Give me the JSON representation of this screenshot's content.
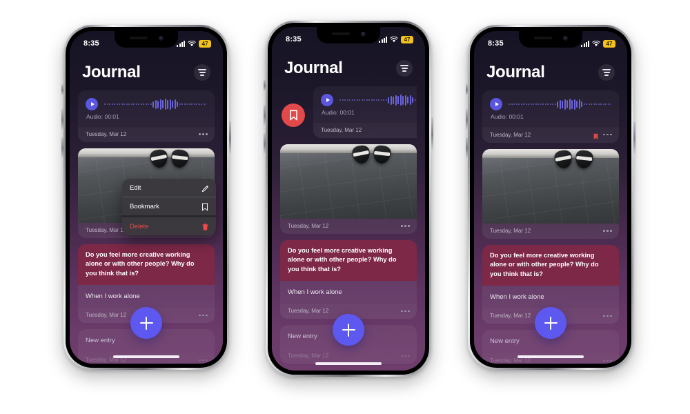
{
  "scene": {
    "background_color": "#ffffff",
    "device_count": 3,
    "app_name": "Journal"
  },
  "status_bar": {
    "time": "8:35",
    "signal_icon": "cellular-signal-icon",
    "wifi_icon": "wifi-icon",
    "battery_level": "47",
    "battery_color": "#f4c21b"
  },
  "header": {
    "title": "Journal",
    "filter_icon": "filter-icon"
  },
  "entries": {
    "audio": {
      "play_icon": "play-icon",
      "label": "Audio: 00:01",
      "date": "Tuesday, Mar 12",
      "menu_icon": "more-options-icon",
      "bookmark_icon": "bookmark-filled-icon"
    },
    "photo": {
      "date": "Tuesday, Mar 12",
      "menu_icon": "more-options-icon",
      "image_alt": "photo-of-tiled-floor-and-shoes"
    },
    "prompt": {
      "question": "Do you feel more creative working alone or with other people? Why do you think that is?",
      "answer": "When I work alone",
      "date": "Tuesday, Mar 12",
      "menu_icon": "more-options-icon",
      "question_bg": "#7d2846"
    },
    "new_entry": {
      "title": "New entry",
      "date": "Tuesday, Mar 12",
      "menu_icon": "more-options-icon"
    }
  },
  "context_menu": {
    "items": [
      {
        "label": "Edit",
        "icon": "pencil-icon",
        "danger": false
      },
      {
        "label": "Bookmark",
        "icon": "bookmark-outline-icon",
        "danger": false
      },
      {
        "label": "Delete",
        "icon": "trash-icon",
        "danger": true
      }
    ],
    "danger_color": "#ef4b4b"
  },
  "swipe_action": {
    "icon": "bookmark-outline-icon",
    "color": "#e2494b"
  },
  "fab": {
    "icon": "plus-icon",
    "color": "#5d58ef"
  },
  "home_indicator": "home-indicator"
}
